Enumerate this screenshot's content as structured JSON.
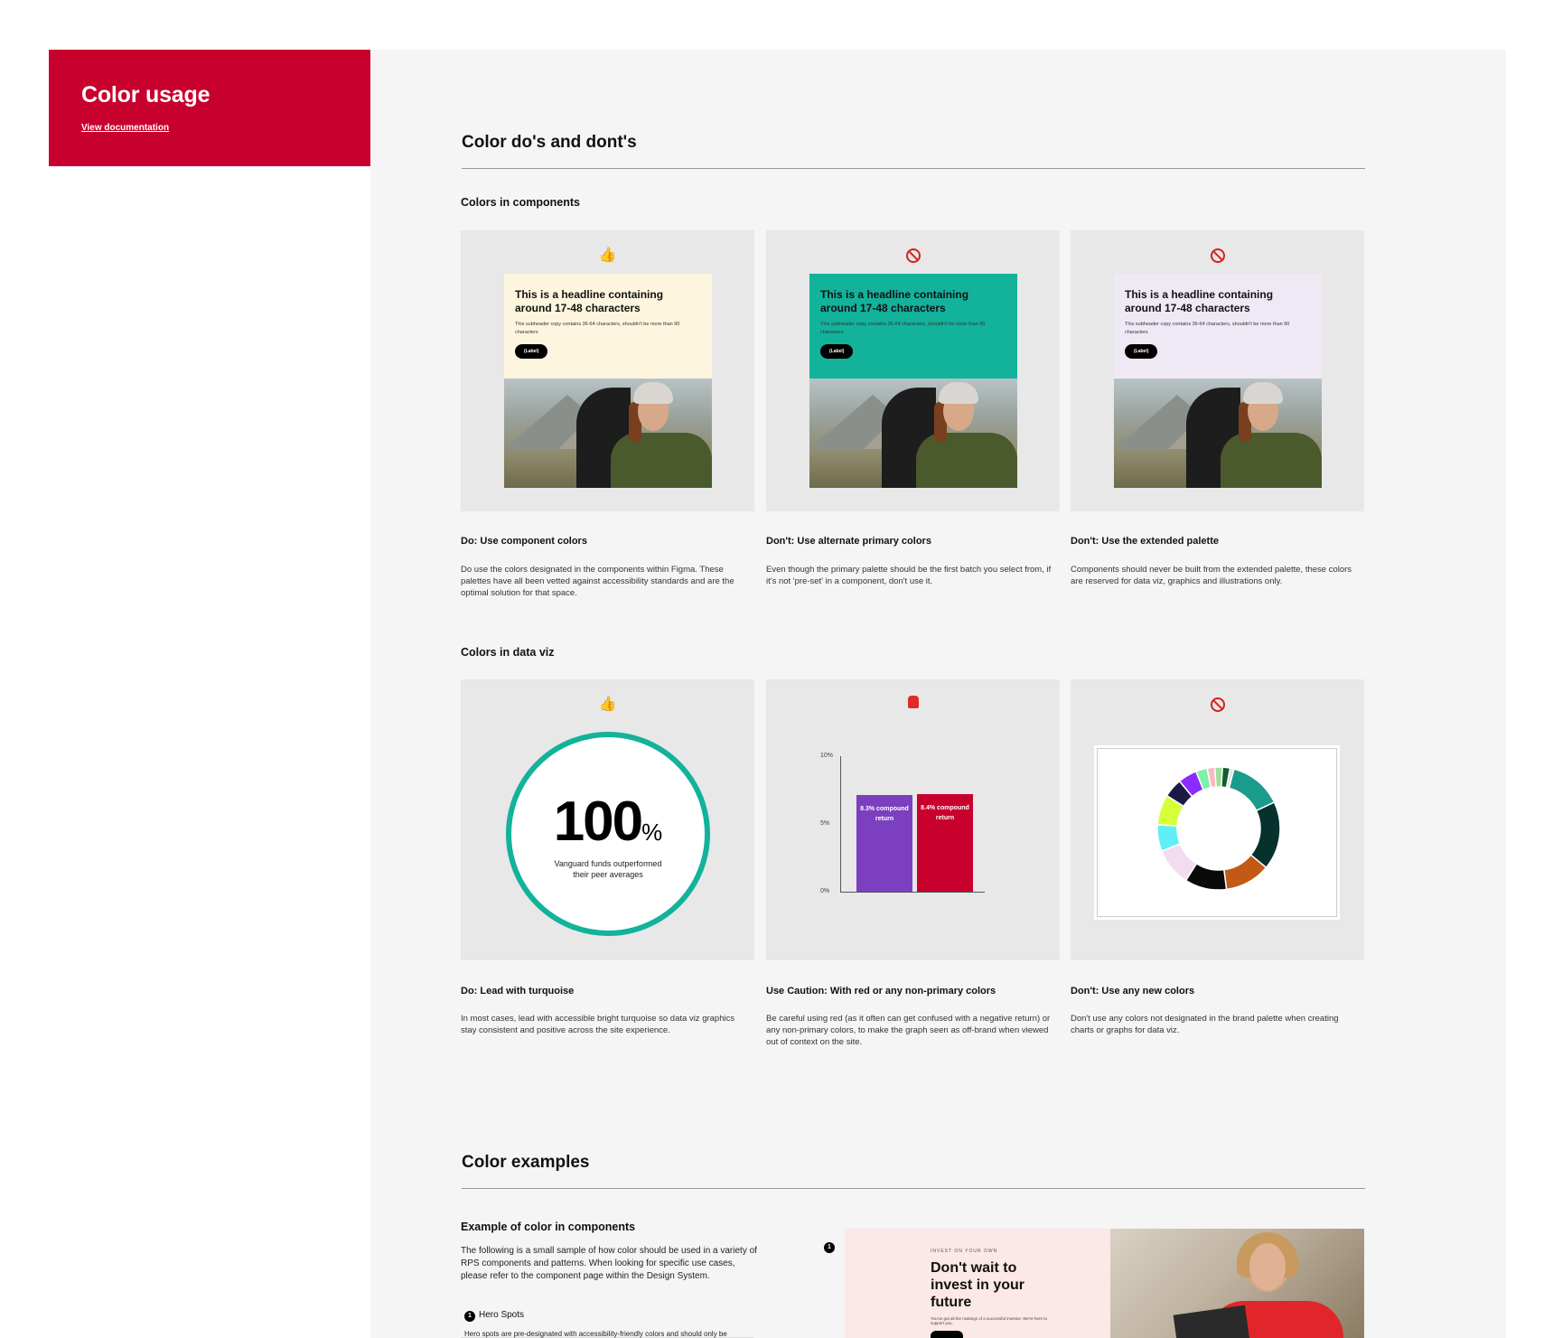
{
  "sidebar": {
    "title": "Color usage",
    "link": "View documentation"
  },
  "dos_donts": {
    "title": "Color do's and dont's",
    "components": {
      "title": "Colors in components",
      "card_headline": "This is a headline containing around 17-48 characters",
      "card_subheader": "This subheader copy contains 36-64 characters, shouldn't be more than 90 characters",
      "card_button": "(Label)",
      "items": [
        {
          "badge": "thumbs-up",
          "heading": "Do: Use component colors",
          "text": "Do use the colors designated in the components within Figma. These palettes have all been vetted against accessibility standards and are the optimal solution for that space.",
          "panel_color": "#fdf5de"
        },
        {
          "badge": "prohibited",
          "heading": "Don't: Use alternate primary colors",
          "text": "Even though the primary palette should be the first batch you select from, if it's not 'pre-set' in a component, don't use it.",
          "panel_color": "#12b29b"
        },
        {
          "badge": "prohibited",
          "heading": "Don't: Use the extended palette",
          "text": "Components should never be built from the extended palette, these colors are reserved for data viz, graphics and illustrations only.",
          "panel_color": "#efe9f6"
        }
      ]
    },
    "dataviz": {
      "title": "Colors in data viz",
      "ring": {
        "value": "100",
        "unit": "%",
        "label": "Vanguard funds outperformed their peer averages",
        "color": "#12b29b"
      },
      "bars": {
        "ticks": [
          "10%",
          "5%",
          "0%"
        ],
        "items": [
          {
            "value": 8.3,
            "label": "8.3% compound return",
            "color": "#7b3fbf"
          },
          {
            "value": 8.4,
            "label": "8.4% compound return",
            "color": "#c8002d"
          }
        ],
        "ymax": 10
      },
      "donut": {
        "slices": [
          {
            "value": 14,
            "color": "#1a9b8c"
          },
          {
            "value": 18,
            "color": "#06312d"
          },
          {
            "value": 12,
            "color": "#c25a16"
          },
          {
            "value": 11,
            "color": "#0a0a0a"
          },
          {
            "value": 10,
            "color": "#f3dcef"
          },
          {
            "value": 7,
            "color": "#5ff0f6"
          },
          {
            "value": 8,
            "color": "#d6ff3a"
          },
          {
            "value": 5,
            "color": "#1c1945"
          },
          {
            "value": 5,
            "color": "#8a2bff"
          },
          {
            "value": 3,
            "color": "#7ef0a9"
          },
          {
            "value": 2,
            "color": "#ffb6c1"
          },
          {
            "value": 2,
            "color": "#9be09b"
          },
          {
            "value": 2,
            "color": "#0f5e2a"
          },
          {
            "value": 1,
            "color": "#e2e2e2"
          }
        ]
      },
      "items": [
        {
          "badge": "thumbs-up",
          "heading": "Do: Lead with turquoise",
          "text": "In most cases, lead with accessible bright turquoise so data viz graphics stay consistent and positive across the site experience."
        },
        {
          "badge": "warning",
          "heading": "Use Caution: With red or any non-primary colors",
          "text": "Be careful using red (as it often can get confused with a negative return) or any non-primary colors, to make the graph seen as off-brand when viewed out of context on the site."
        },
        {
          "badge": "prohibited",
          "heading": "Don't: Use any new colors",
          "text": "Don't use any colors not designated in the brand palette when creating charts or graphs for data viz."
        }
      ]
    }
  },
  "examples": {
    "title": "Color examples",
    "subtitle": "Example of color in components",
    "desc": "The following is a small sample of how color should be used in a variety of RPS components and patterns. When looking for specific use cases, please refer to the component page within the Design System.",
    "list_item_number": "1",
    "list_item_label": "Hero Spots",
    "list_item_text": "Hero spots are pre-designated with accessibility-friendly colors and should only be",
    "hero_marker": "1",
    "hero": {
      "eyebrow": "INVEST ON YOUR OWN",
      "headline": "Don't wait to invest in your future",
      "body": "You've got all the makings of a successful investor. We're here to support you.",
      "panel_color": "#fce8e6"
    }
  }
}
